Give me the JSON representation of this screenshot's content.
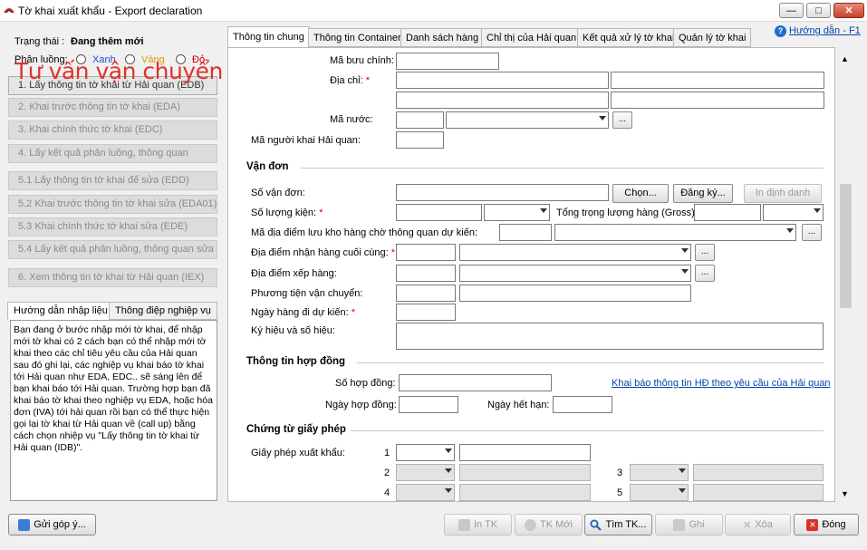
{
  "window": {
    "title": "Tờ khai xuất khẩu - Export declaration",
    "minimize": "—",
    "maximize": "□",
    "close": "✕"
  },
  "left": {
    "status_label": "Trạng thái :",
    "status_value": "Đang thêm mới",
    "watermark": "Tư vấn vận chuyển",
    "flow_label": "Phân luồng:",
    "flow_options": [
      "Xanh",
      "Vàng",
      "Đỏ"
    ],
    "flow_colors": [
      "#1a52c8",
      "#d49a00",
      "#d00000"
    ],
    "buttons": [
      "1. Lấy thông tin tờ khai từ Hải quan (EDB)",
      "2. Khai trước thông tin tờ khai (EDA)",
      "3. Khai chính thức tờ khai (EDC)",
      "4. Lấy kết quả phân luồng, thông quan",
      "5.1 Lấy thông tin tờ khai để sửa (EDD)",
      "5.2 Khai trước thông tin tờ khai sửa (EDA01)",
      "5.3 Khai chính thức tờ khai sửa (EDE)",
      "5.4 Lấy kết quả phân luồng, thông quan sửa",
      "6. Xem thông tin tờ khai từ Hải quan (IEX)"
    ],
    "tabs": [
      "Hướng dẫn nhập liệu",
      "Thông điệp nghiệp vụ"
    ],
    "guide_text": "Bạn đang ở bước nhập mới tờ khai, để nhập mới tờ khai có 2 cách bạn có thể nhập mới tờ khai theo các chỉ tiêu yêu cầu của Hải quan sau đó ghi lại, các nghiệp vụ khai báo tờ khai tới Hải quan như EDA, EDC.. sẽ sáng lên để bạn khai báo tới Hải quan. Trường hợp bạn đã khai báo tờ khai theo nghiệp vụ EDA, hoặc hóa đơn (IVA) tới hải quan rồi bạn có thể thực hiện gọi lại tờ khai từ Hải quan về (call up) bằng cách chọn nhiệp vụ \"Lấy thông tin tờ khai từ Hải quan (IDB)\"."
  },
  "tabs": [
    "Thông tin chung",
    "Thông tin Container",
    "Danh sách hàng",
    "Chỉ thị của Hải quan",
    "Kết quả xử lý tờ khai",
    "Quản lý tờ khai"
  ],
  "help_link": "Hướng dẫn - F1",
  "form": {
    "postal_code": "Mã bưu chính:",
    "address": "Địa chỉ:",
    "country_code": "Mã nước:",
    "declarant_code": "Mã người khai Hải quan:",
    "section_bill": "Vận đơn",
    "bill_no": "Số vận đơn:",
    "btn_choose": "Chọn...",
    "btn_register": "Đăng ký...",
    "btn_print_id": "In định danh",
    "quantity": "Số lượng kiện:",
    "gross_weight": "Tổng trọng lượng hàng (Gross):",
    "warehouse_code": "Mã địa điểm lưu kho hàng chờ thông quan dự kiến:",
    "final_receipt": "Địa điểm nhận hàng cuối cùng:",
    "loading_place": "Địa điểm xếp hàng:",
    "transport": "Phương tiện vận chuyển:",
    "departure_date": "Ngày hàng đi dự kiến:",
    "marks": "Ký hiệu và số hiệu:",
    "section_contract": "Thông tin hợp đồng",
    "contract_no": "Số hợp đồng:",
    "contract_date": "Ngày hợp đồng:",
    "expiry_date": "Ngày hết hạn:",
    "contract_link": "Khai báo thông tin HĐ theo yêu cầu của Hải quan",
    "section_license": "Chứng từ giấy phép",
    "export_license": "Giấy phép xuất khẩu:",
    "license_rows": [
      "1",
      "2",
      "3",
      "4",
      "5"
    ],
    "more": "..."
  },
  "bottom": {
    "feedback": "Gửi góp ý...",
    "print": "In TK",
    "new": "TK Mới",
    "find": "Tìm TK...",
    "save": "Ghi",
    "delete": "Xóa",
    "close": "Đóng"
  }
}
